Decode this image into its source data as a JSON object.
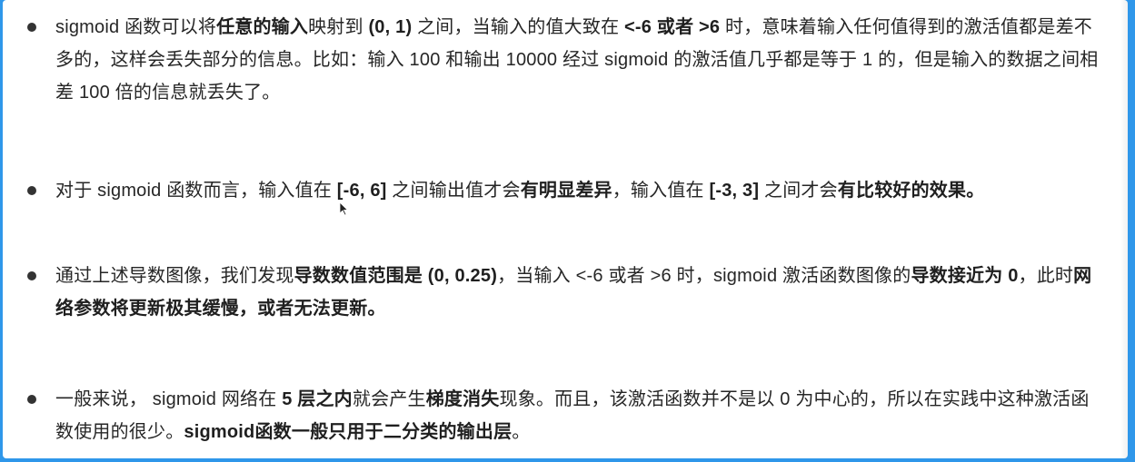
{
  "bullets": [
    {
      "segments": [
        {
          "text": "sigmoid 函数可以将",
          "bold": false
        },
        {
          "text": "任意的输入",
          "bold": true
        },
        {
          "text": "映射到 ",
          "bold": false
        },
        {
          "text": "(0, 1)",
          "bold": true
        },
        {
          "text": " 之间，当输入的值大致在 ",
          "bold": false
        },
        {
          "text": "<-6 或者 >6",
          "bold": true
        },
        {
          "text": " 时，意味着输入任何值得到的激活值都是差不多的，这样会丢失部分的信息。比如：输入 100 和输出 10000 经过 sigmoid 的激活值几乎都是等于 1 的，但是输入的数据之间相差 100 倍的信息就丢失了。",
          "bold": false
        }
      ]
    },
    {
      "segments": [
        {
          "text": "对于 sigmoid 函数而言，输入值在 ",
          "bold": false
        },
        {
          "text": "[-6, 6]",
          "bold": true
        },
        {
          "text": " 之间输出值才会",
          "bold": false
        },
        {
          "text": "有明显差异",
          "bold": true
        },
        {
          "text": "，输入值在 ",
          "bold": false
        },
        {
          "text": "[-3, 3]",
          "bold": true
        },
        {
          "text": " 之间才会",
          "bold": false
        },
        {
          "text": "有比较好的效果。",
          "bold": true
        }
      ]
    },
    {
      "segments": [
        {
          "text": "通过上述导数图像，我们发现",
          "bold": false
        },
        {
          "text": "导数数值范围是 (0, 0.25)",
          "bold": true
        },
        {
          "text": "，当输入 <-6 或者 >6 时，sigmoid 激活函数图像的",
          "bold": false
        },
        {
          "text": "导数接近为 0",
          "bold": true
        },
        {
          "text": "，此时",
          "bold": false
        },
        {
          "text": "网络参数将更新极其缓慢，或者无法更新。",
          "bold": true
        }
      ]
    },
    {
      "segments": [
        {
          "text": "一般来说， sigmoid 网络在 ",
          "bold": false
        },
        {
          "text": "5 层之内",
          "bold": true
        },
        {
          "text": "就会产生",
          "bold": false
        },
        {
          "text": "梯度消失",
          "bold": true
        },
        {
          "text": "现象。而且，该激活函数并不是以 0 为中心的，所以在实践中这种激活函数使用的很少。",
          "bold": false
        },
        {
          "text": "sigmoid函数一般只用于二分类的输出层",
          "bold": true
        },
        {
          "text": "。",
          "bold": false
        }
      ]
    }
  ]
}
